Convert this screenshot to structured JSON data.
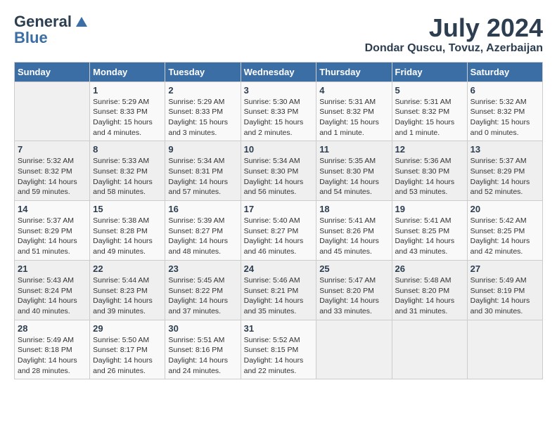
{
  "logo": {
    "general": "General",
    "blue": "Blue"
  },
  "title": {
    "month": "July 2024",
    "location": "Dondar Quscu, Tovuz, Azerbaijan"
  },
  "headers": [
    "Sunday",
    "Monday",
    "Tuesday",
    "Wednesday",
    "Thursday",
    "Friday",
    "Saturday"
  ],
  "weeks": [
    [
      {
        "day": "",
        "sunrise": "",
        "sunset": "",
        "daylight": ""
      },
      {
        "day": "1",
        "sunrise": "Sunrise: 5:29 AM",
        "sunset": "Sunset: 8:33 PM",
        "daylight": "Daylight: 15 hours and 4 minutes."
      },
      {
        "day": "2",
        "sunrise": "Sunrise: 5:29 AM",
        "sunset": "Sunset: 8:33 PM",
        "daylight": "Daylight: 15 hours and 3 minutes."
      },
      {
        "day": "3",
        "sunrise": "Sunrise: 5:30 AM",
        "sunset": "Sunset: 8:33 PM",
        "daylight": "Daylight: 15 hours and 2 minutes."
      },
      {
        "day": "4",
        "sunrise": "Sunrise: 5:31 AM",
        "sunset": "Sunset: 8:32 PM",
        "daylight": "Daylight: 15 hours and 1 minute."
      },
      {
        "day": "5",
        "sunrise": "Sunrise: 5:31 AM",
        "sunset": "Sunset: 8:32 PM",
        "daylight": "Daylight: 15 hours and 1 minute."
      },
      {
        "day": "6",
        "sunrise": "Sunrise: 5:32 AM",
        "sunset": "Sunset: 8:32 PM",
        "daylight": "Daylight: 15 hours and 0 minutes."
      }
    ],
    [
      {
        "day": "7",
        "sunrise": "Sunrise: 5:32 AM",
        "sunset": "Sunset: 8:32 PM",
        "daylight": "Daylight: 14 hours and 59 minutes."
      },
      {
        "day": "8",
        "sunrise": "Sunrise: 5:33 AM",
        "sunset": "Sunset: 8:32 PM",
        "daylight": "Daylight: 14 hours and 58 minutes."
      },
      {
        "day": "9",
        "sunrise": "Sunrise: 5:34 AM",
        "sunset": "Sunset: 8:31 PM",
        "daylight": "Daylight: 14 hours and 57 minutes."
      },
      {
        "day": "10",
        "sunrise": "Sunrise: 5:34 AM",
        "sunset": "Sunset: 8:30 PM",
        "daylight": "Daylight: 14 hours and 56 minutes."
      },
      {
        "day": "11",
        "sunrise": "Sunrise: 5:35 AM",
        "sunset": "Sunset: 8:30 PM",
        "daylight": "Daylight: 14 hours and 54 minutes."
      },
      {
        "day": "12",
        "sunrise": "Sunrise: 5:36 AM",
        "sunset": "Sunset: 8:30 PM",
        "daylight": "Daylight: 14 hours and 53 minutes."
      },
      {
        "day": "13",
        "sunrise": "Sunrise: 5:37 AM",
        "sunset": "Sunset: 8:29 PM",
        "daylight": "Daylight: 14 hours and 52 minutes."
      }
    ],
    [
      {
        "day": "14",
        "sunrise": "Sunrise: 5:37 AM",
        "sunset": "Sunset: 8:29 PM",
        "daylight": "Daylight: 14 hours and 51 minutes."
      },
      {
        "day": "15",
        "sunrise": "Sunrise: 5:38 AM",
        "sunset": "Sunset: 8:28 PM",
        "daylight": "Daylight: 14 hours and 49 minutes."
      },
      {
        "day": "16",
        "sunrise": "Sunrise: 5:39 AM",
        "sunset": "Sunset: 8:27 PM",
        "daylight": "Daylight: 14 hours and 48 minutes."
      },
      {
        "day": "17",
        "sunrise": "Sunrise: 5:40 AM",
        "sunset": "Sunset: 8:27 PM",
        "daylight": "Daylight: 14 hours and 46 minutes."
      },
      {
        "day": "18",
        "sunrise": "Sunrise: 5:41 AM",
        "sunset": "Sunset: 8:26 PM",
        "daylight": "Daylight: 14 hours and 45 minutes."
      },
      {
        "day": "19",
        "sunrise": "Sunrise: 5:41 AM",
        "sunset": "Sunset: 8:25 PM",
        "daylight": "Daylight: 14 hours and 43 minutes."
      },
      {
        "day": "20",
        "sunrise": "Sunrise: 5:42 AM",
        "sunset": "Sunset: 8:25 PM",
        "daylight": "Daylight: 14 hours and 42 minutes."
      }
    ],
    [
      {
        "day": "21",
        "sunrise": "Sunrise: 5:43 AM",
        "sunset": "Sunset: 8:24 PM",
        "daylight": "Daylight: 14 hours and 40 minutes."
      },
      {
        "day": "22",
        "sunrise": "Sunrise: 5:44 AM",
        "sunset": "Sunset: 8:23 PM",
        "daylight": "Daylight: 14 hours and 39 minutes."
      },
      {
        "day": "23",
        "sunrise": "Sunrise: 5:45 AM",
        "sunset": "Sunset: 8:22 PM",
        "daylight": "Daylight: 14 hours and 37 minutes."
      },
      {
        "day": "24",
        "sunrise": "Sunrise: 5:46 AM",
        "sunset": "Sunset: 8:21 PM",
        "daylight": "Daylight: 14 hours and 35 minutes."
      },
      {
        "day": "25",
        "sunrise": "Sunrise: 5:47 AM",
        "sunset": "Sunset: 8:20 PM",
        "daylight": "Daylight: 14 hours and 33 minutes."
      },
      {
        "day": "26",
        "sunrise": "Sunrise: 5:48 AM",
        "sunset": "Sunset: 8:20 PM",
        "daylight": "Daylight: 14 hours and 31 minutes."
      },
      {
        "day": "27",
        "sunrise": "Sunrise: 5:49 AM",
        "sunset": "Sunset: 8:19 PM",
        "daylight": "Daylight: 14 hours and 30 minutes."
      }
    ],
    [
      {
        "day": "28",
        "sunrise": "Sunrise: 5:49 AM",
        "sunset": "Sunset: 8:18 PM",
        "daylight": "Daylight: 14 hours and 28 minutes."
      },
      {
        "day": "29",
        "sunrise": "Sunrise: 5:50 AM",
        "sunset": "Sunset: 8:17 PM",
        "daylight": "Daylight: 14 hours and 26 minutes."
      },
      {
        "day": "30",
        "sunrise": "Sunrise: 5:51 AM",
        "sunset": "Sunset: 8:16 PM",
        "daylight": "Daylight: 14 hours and 24 minutes."
      },
      {
        "day": "31",
        "sunrise": "Sunrise: 5:52 AM",
        "sunset": "Sunset: 8:15 PM",
        "daylight": "Daylight: 14 hours and 22 minutes."
      },
      {
        "day": "",
        "sunrise": "",
        "sunset": "",
        "daylight": ""
      },
      {
        "day": "",
        "sunrise": "",
        "sunset": "",
        "daylight": ""
      },
      {
        "day": "",
        "sunrise": "",
        "sunset": "",
        "daylight": ""
      }
    ]
  ]
}
